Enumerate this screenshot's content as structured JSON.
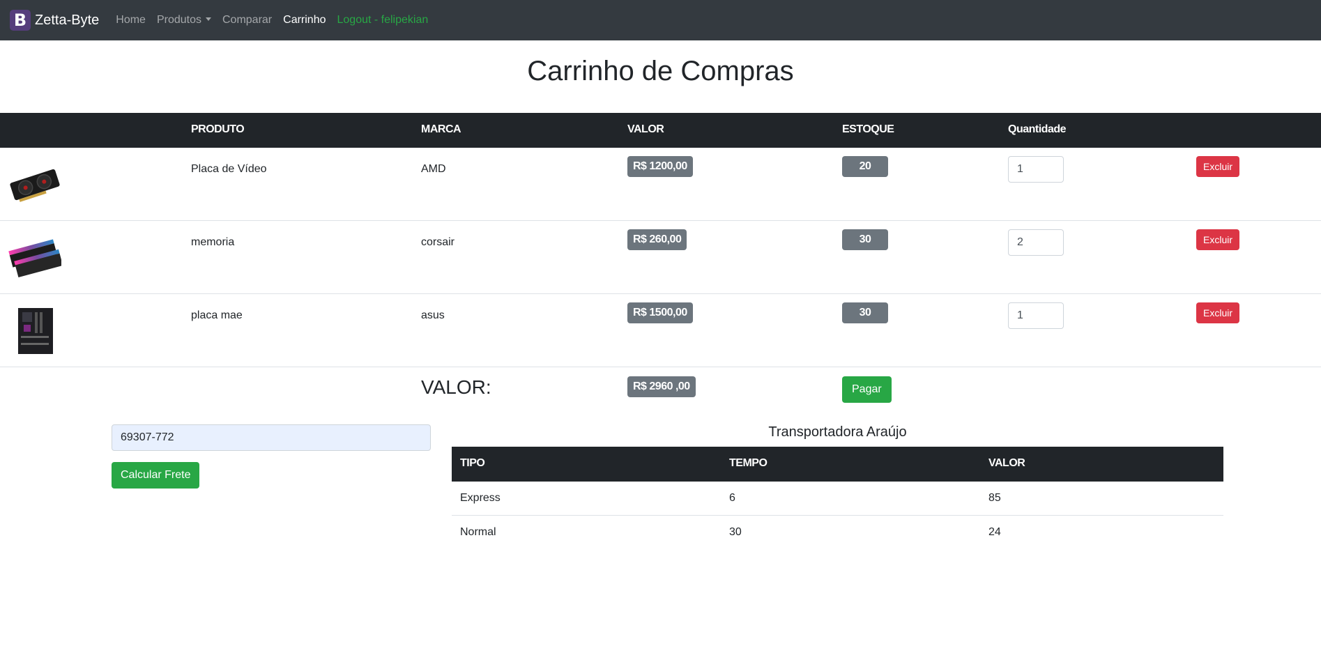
{
  "navbar": {
    "brand_letter": "B",
    "brand_name": "Zetta-Byte",
    "links": {
      "home": "Home",
      "produtos": "Produtos",
      "comparar": "Comparar",
      "carrinho": "Carrinho",
      "logout": "Logout - felipekian"
    }
  },
  "page_title": "Carrinho de Compras",
  "cart": {
    "headers": [
      "",
      "PRODUTO",
      "MARCA",
      "VALOR",
      "ESTOQUE",
      "Quantidade"
    ],
    "rows": [
      {
        "produto": "Placa de Vídeo",
        "marca": "AMD",
        "valor": "R$ 1200,00",
        "estoque": "20",
        "quantidade": "1",
        "excluir": "Excluir",
        "image": "gpu-image"
      },
      {
        "produto": "memoria",
        "marca": "corsair",
        "valor": "R$ 260,00",
        "estoque": "30",
        "quantidade": "2",
        "excluir": "Excluir",
        "image": "ram-image"
      },
      {
        "produto": "placa mae",
        "marca": "asus",
        "valor": "R$ 1500,00",
        "estoque": "30",
        "quantidade": "1",
        "excluir": "Excluir",
        "image": "motherboard-image"
      }
    ],
    "total_label": "VALOR:",
    "total_value": "R$ 2960 ,00",
    "pay_label": "Pagar"
  },
  "shipping": {
    "cep_value": "69307-772",
    "calc_label": "Calcular Frete",
    "title": "Transportadora Araújo",
    "headers": [
      "TIPO",
      "TEMPO",
      "VALOR"
    ],
    "rows": [
      {
        "tipo": "Express",
        "tempo": "6",
        "valor": "85"
      },
      {
        "tipo": "Normal",
        "tempo": "30",
        "valor": "24"
      }
    ]
  },
  "colors": {
    "navbar_bg": "#343a40",
    "table_head_bg": "#212529",
    "badge_gray": "#6c757d",
    "danger": "#dc3545",
    "success": "#28a745",
    "brand_purple": "#563d7c"
  }
}
